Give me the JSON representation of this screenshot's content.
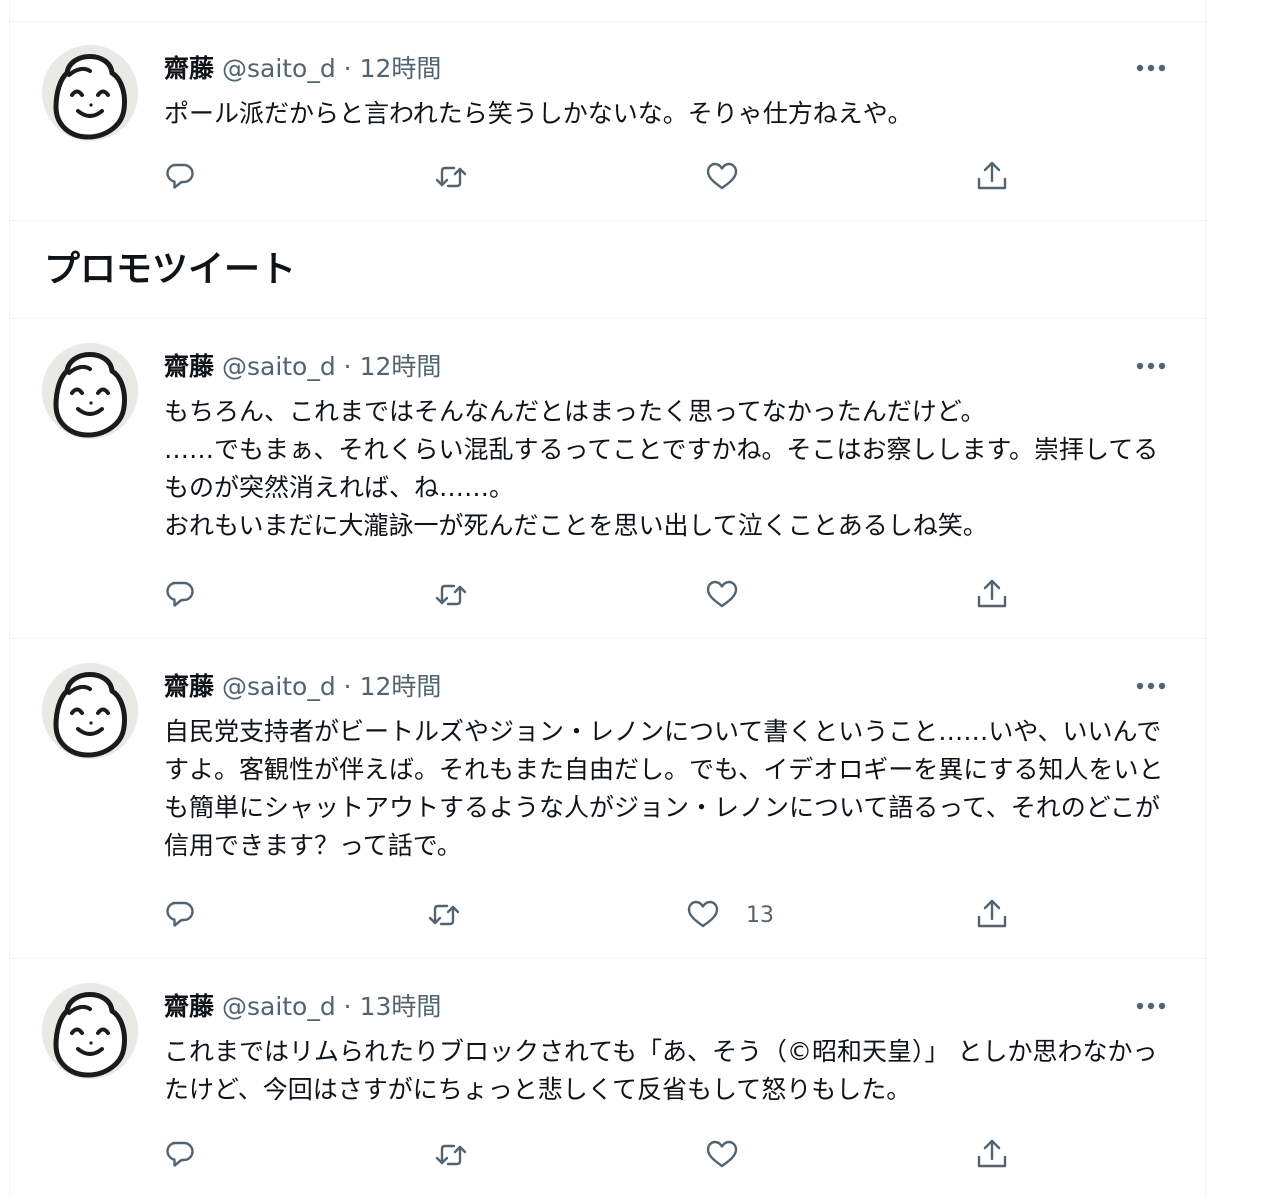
{
  "promoted_heading": "プロモツイート",
  "tweets": [
    {
      "name": "齋藤",
      "handle": "@saito_d",
      "separator": " · ",
      "time": "12時間",
      "text": "ポール派だからと言われたら笑うしかないな。そりゃ仕方ねえや。",
      "like_count": ""
    },
    {
      "name": "齋藤",
      "handle": "@saito_d",
      "separator": " · ",
      "time": "12時間",
      "text": "もちろん、これまではそんなんだとはまったく思ってなかったんだけど。\n……でもまぁ、それくらい混乱するってことですかね。そこはお察しします。崇拝してるものが突然消えれば、ね……。\nおれもいまだに大瀧詠一が死んだことを思い出して泣くことあるしね笑。",
      "like_count": ""
    },
    {
      "name": "齋藤",
      "handle": "@saito_d",
      "separator": " · ",
      "time": "12時間",
      "text": "自民党支持者がビートルズやジョン・レノンについて書くということ……いや、いいんですよ。客観性が伴えば。それもまた自由だし。でも、イデオロギーを異にする知人をいとも簡単にシャットアウトするような人がジョン・レノンについて語るって、それのどこが信用できます？って話で。",
      "like_count": "13"
    },
    {
      "name": "齋藤",
      "handle": "@saito_d",
      "separator": " · ",
      "time": "13時間",
      "text": "これまではリムられたりブロックされても「あ、そう（©昭和天皇）」 としか思わなかったけど、今回はさすがにちょっと悲しくて反省もして怒りもした。",
      "like_count": ""
    }
  ],
  "icons": {
    "reply": "reply-icon",
    "retweet": "retweet-icon",
    "like": "like-icon",
    "share": "share-icon",
    "more": "more-icon"
  },
  "colors": {
    "text": "#0f1419",
    "secondary": "#536471",
    "border": "#eff3f4"
  }
}
